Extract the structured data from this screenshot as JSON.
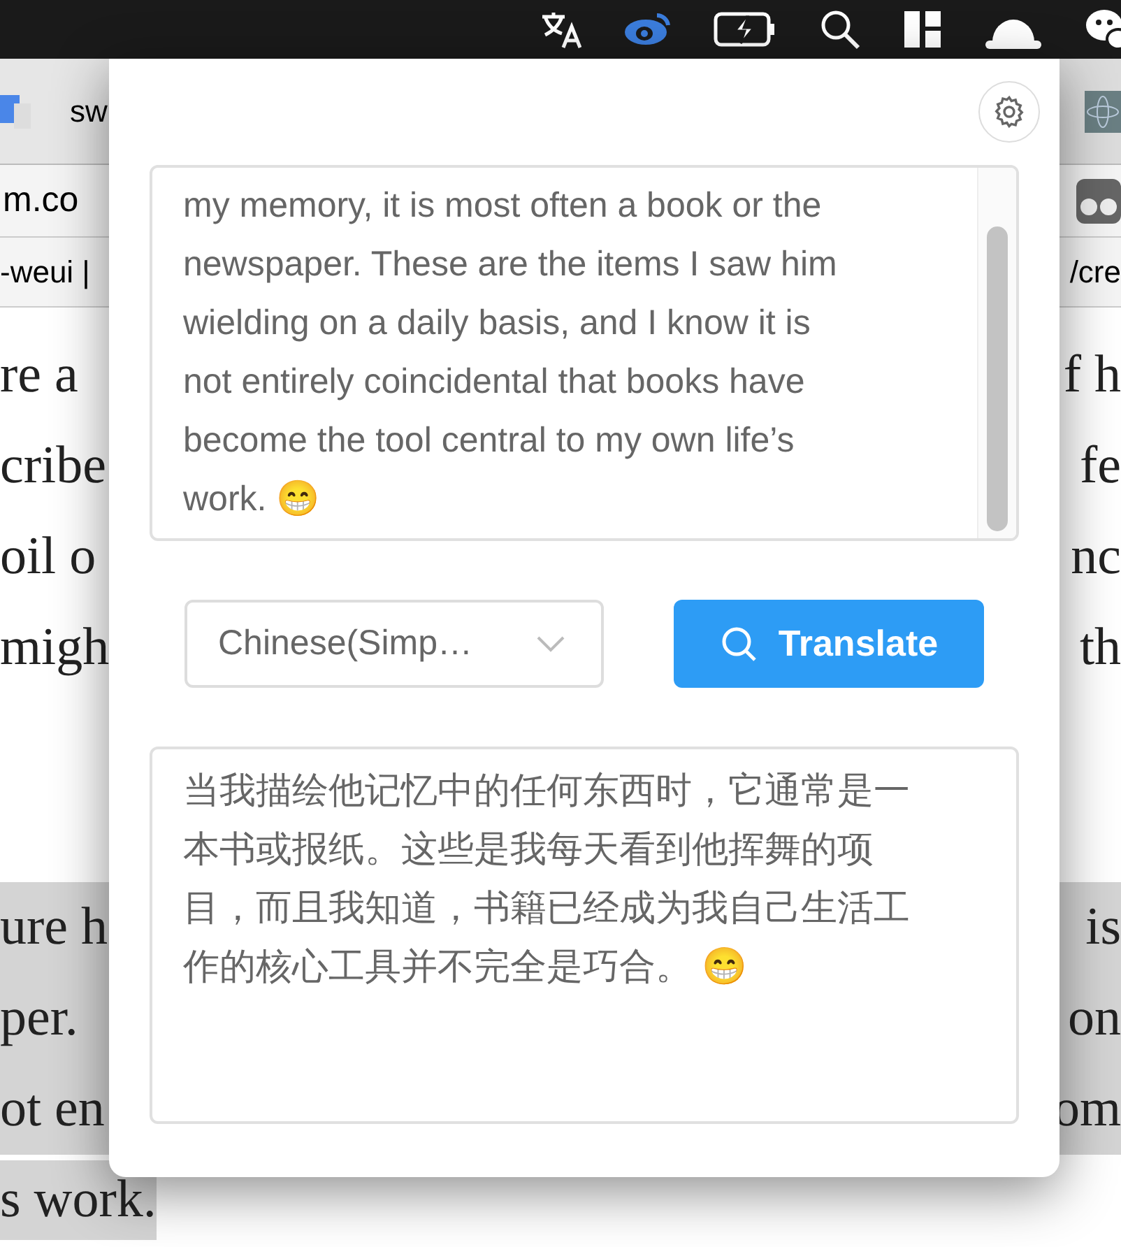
{
  "browser": {
    "tab_label": "sw",
    "address_fragment": "m.co",
    "bookmark_left": "-weui |",
    "bookmark_right": "/cre"
  },
  "page_paragraphs": [
    {
      "lines": [
        {
          "left": "re a",
          "right": "f h",
          "selected": false
        },
        {
          "left": "cribe",
          "right": "fe",
          "selected": false
        },
        {
          "left": "oil o",
          "right": "nc",
          "selected": false
        },
        {
          "left": "migh",
          "right": "th",
          "selected": false
        }
      ]
    },
    {
      "lines": [
        {
          "left": "ure h",
          "right": "is",
          "selected": true
        },
        {
          "left": "per.",
          "right": "on",
          "selected": true
        },
        {
          "left": "ot en",
          "right": "om",
          "selected": true
        },
        {
          "left": "s work.",
          "selected": true
        }
      ]
    }
  ],
  "popup": {
    "source_text": "my memory, it is most often a book or the newspaper. These are the items I saw him wielding on a daily basis, and I know it is not entirely coincidental that books have become the tool central to my own life’s work. 😁",
    "target_language": "Chinese(Simp…",
    "translate_button": "Translate",
    "result_text": "当我描绘他记忆中的任何东西时，它通常是一本书或报纸。这些是我每天看到他挥舞的项目，而且我知道，书籍已经成为我自己生活工作的核心工具并不完全是巧合。 😁"
  }
}
